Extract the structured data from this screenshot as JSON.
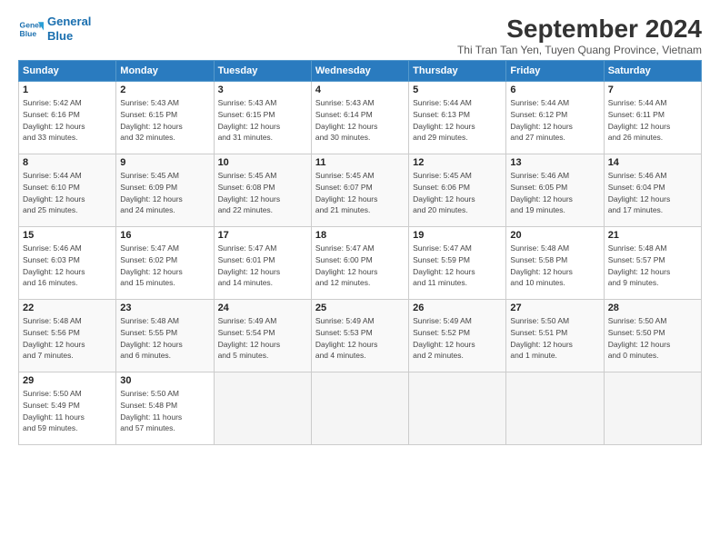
{
  "header": {
    "logo_line1": "General",
    "logo_line2": "Blue",
    "month_title": "September 2024",
    "subtitle": "Thi Tran Tan Yen, Tuyen Quang Province, Vietnam"
  },
  "columns": [
    "Sunday",
    "Monday",
    "Tuesday",
    "Wednesday",
    "Thursday",
    "Friday",
    "Saturday"
  ],
  "weeks": [
    [
      {
        "day": "1",
        "info": "Sunrise: 5:42 AM\nSunset: 6:16 PM\nDaylight: 12 hours\nand 33 minutes."
      },
      {
        "day": "2",
        "info": "Sunrise: 5:43 AM\nSunset: 6:15 PM\nDaylight: 12 hours\nand 32 minutes."
      },
      {
        "day": "3",
        "info": "Sunrise: 5:43 AM\nSunset: 6:15 PM\nDaylight: 12 hours\nand 31 minutes."
      },
      {
        "day": "4",
        "info": "Sunrise: 5:43 AM\nSunset: 6:14 PM\nDaylight: 12 hours\nand 30 minutes."
      },
      {
        "day": "5",
        "info": "Sunrise: 5:44 AM\nSunset: 6:13 PM\nDaylight: 12 hours\nand 29 minutes."
      },
      {
        "day": "6",
        "info": "Sunrise: 5:44 AM\nSunset: 6:12 PM\nDaylight: 12 hours\nand 27 minutes."
      },
      {
        "day": "7",
        "info": "Sunrise: 5:44 AM\nSunset: 6:11 PM\nDaylight: 12 hours\nand 26 minutes."
      }
    ],
    [
      {
        "day": "8",
        "info": "Sunrise: 5:44 AM\nSunset: 6:10 PM\nDaylight: 12 hours\nand 25 minutes."
      },
      {
        "day": "9",
        "info": "Sunrise: 5:45 AM\nSunset: 6:09 PM\nDaylight: 12 hours\nand 24 minutes."
      },
      {
        "day": "10",
        "info": "Sunrise: 5:45 AM\nSunset: 6:08 PM\nDaylight: 12 hours\nand 22 minutes."
      },
      {
        "day": "11",
        "info": "Sunrise: 5:45 AM\nSunset: 6:07 PM\nDaylight: 12 hours\nand 21 minutes."
      },
      {
        "day": "12",
        "info": "Sunrise: 5:45 AM\nSunset: 6:06 PM\nDaylight: 12 hours\nand 20 minutes."
      },
      {
        "day": "13",
        "info": "Sunrise: 5:46 AM\nSunset: 6:05 PM\nDaylight: 12 hours\nand 19 minutes."
      },
      {
        "day": "14",
        "info": "Sunrise: 5:46 AM\nSunset: 6:04 PM\nDaylight: 12 hours\nand 17 minutes."
      }
    ],
    [
      {
        "day": "15",
        "info": "Sunrise: 5:46 AM\nSunset: 6:03 PM\nDaylight: 12 hours\nand 16 minutes."
      },
      {
        "day": "16",
        "info": "Sunrise: 5:47 AM\nSunset: 6:02 PM\nDaylight: 12 hours\nand 15 minutes."
      },
      {
        "day": "17",
        "info": "Sunrise: 5:47 AM\nSunset: 6:01 PM\nDaylight: 12 hours\nand 14 minutes."
      },
      {
        "day": "18",
        "info": "Sunrise: 5:47 AM\nSunset: 6:00 PM\nDaylight: 12 hours\nand 12 minutes."
      },
      {
        "day": "19",
        "info": "Sunrise: 5:47 AM\nSunset: 5:59 PM\nDaylight: 12 hours\nand 11 minutes."
      },
      {
        "day": "20",
        "info": "Sunrise: 5:48 AM\nSunset: 5:58 PM\nDaylight: 12 hours\nand 10 minutes."
      },
      {
        "day": "21",
        "info": "Sunrise: 5:48 AM\nSunset: 5:57 PM\nDaylight: 12 hours\nand 9 minutes."
      }
    ],
    [
      {
        "day": "22",
        "info": "Sunrise: 5:48 AM\nSunset: 5:56 PM\nDaylight: 12 hours\nand 7 minutes."
      },
      {
        "day": "23",
        "info": "Sunrise: 5:48 AM\nSunset: 5:55 PM\nDaylight: 12 hours\nand 6 minutes."
      },
      {
        "day": "24",
        "info": "Sunrise: 5:49 AM\nSunset: 5:54 PM\nDaylight: 12 hours\nand 5 minutes."
      },
      {
        "day": "25",
        "info": "Sunrise: 5:49 AM\nSunset: 5:53 PM\nDaylight: 12 hours\nand 4 minutes."
      },
      {
        "day": "26",
        "info": "Sunrise: 5:49 AM\nSunset: 5:52 PM\nDaylight: 12 hours\nand 2 minutes."
      },
      {
        "day": "27",
        "info": "Sunrise: 5:50 AM\nSunset: 5:51 PM\nDaylight: 12 hours\nand 1 minute."
      },
      {
        "day": "28",
        "info": "Sunrise: 5:50 AM\nSunset: 5:50 PM\nDaylight: 12 hours\nand 0 minutes."
      }
    ],
    [
      {
        "day": "29",
        "info": "Sunrise: 5:50 AM\nSunset: 5:49 PM\nDaylight: 11 hours\nand 59 minutes."
      },
      {
        "day": "30",
        "info": "Sunrise: 5:50 AM\nSunset: 5:48 PM\nDaylight: 11 hours\nand 57 minutes."
      },
      null,
      null,
      null,
      null,
      null
    ]
  ]
}
